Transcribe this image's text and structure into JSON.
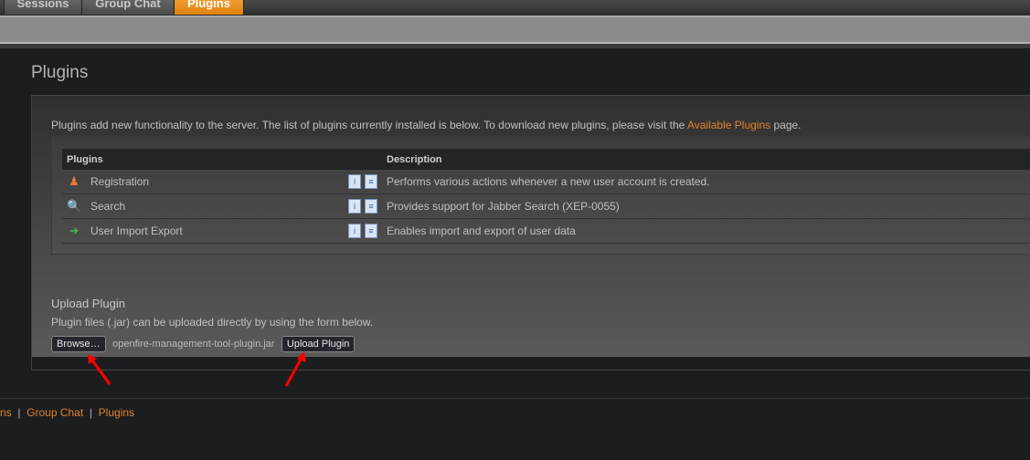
{
  "tabs": [
    {
      "label": "Sessions"
    },
    {
      "label": "Group Chat"
    },
    {
      "label": "Plugins",
      "active": true
    }
  ],
  "page_title": "Plugins",
  "intro": {
    "text": "Plugins add new functionality to the server. The list of plugins currently installed is below. To download new plugins, please visit the ",
    "link": "Available Plugins",
    "suffix": " page."
  },
  "table": {
    "headers": [
      "Plugins",
      "Description"
    ],
    "rows": [
      {
        "name": "Registration",
        "icon": "user-add-icon",
        "description": "Performs various actions whenever a new user account is created."
      },
      {
        "name": "Search",
        "icon": "magnifier-icon",
        "description": "Provides support for Jabber Search (XEP-0055)"
      },
      {
        "name": "User Import Export",
        "icon": "user-export-icon",
        "description": "Enables import and export of user data"
      }
    ]
  },
  "upload": {
    "title": "Upload Plugin",
    "description": "Plugin files (.jar) can be uploaded directly by using the form below.",
    "browse_label": "Browse…",
    "file_name": "openfire-management-tool-plugin.jar",
    "upload_label": "Upload Plugin"
  },
  "footer": {
    "links": [
      "ns",
      "Group Chat",
      "Plugins"
    ],
    "separator": "|"
  },
  "colors": {
    "accent": "#e0822a",
    "annotation_arrow": "#ff0000"
  }
}
